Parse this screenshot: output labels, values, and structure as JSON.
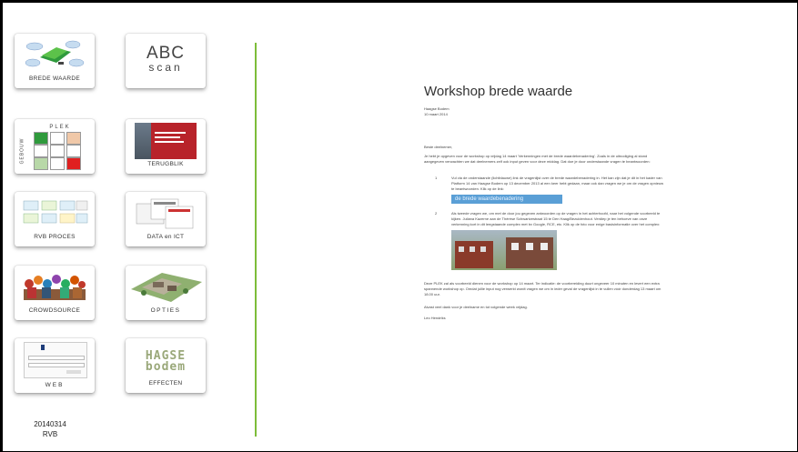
{
  "tiles": {
    "brede_waarde": "BREDE WAARDE",
    "abc_scan": {
      "line1": "ABC",
      "line2": "scan"
    },
    "plek": {
      "top": "PLEK",
      "side": "GEBOUW"
    },
    "terugblik": {
      "caption": "TERUGBLIK"
    },
    "rvb_proces": "RVB PROCES",
    "data_ict": "DATA en ICT",
    "crowdsource": "CROWDSOURCE",
    "opties": "OPTIES",
    "web": "WEB",
    "effecten": {
      "caption": "EFFECTEN",
      "logo_line1": "HAGSE",
      "logo_line2": "bodem"
    }
  },
  "footer": {
    "date": "20140314",
    "org": "RVB"
  },
  "document": {
    "title": "Workshop brede waarde",
    "subtitle_line1": "Haagse Bodem",
    "subtitle_line2": "10 maart 2014",
    "greeting": "Beste deelnemer,",
    "intro": "Je hebt je opgeven voor de workshop op vrijdag 14 maart 'Verkenningen met de brede waardebenadering'. Zoals in de uitnodiging al stond aangegeven verwachten we dat deelnemers zelf ook input geven voor deze middag. Dat doe je door onderstaande vragen te beantwoorden:",
    "item1_num": "1",
    "item1_text": "Vul via de onderstaande (lichtblauwe) link de vragenlijst over de brede waardebenadering in. Het kan zijn dat je dit in het kader van Platform 14 van Haagse Bodem op 13 december 2013 al een keer hebt gedaan, maar ook dan vragen we je om de vragen opnieuw te beantwoorden. Klik op de link:",
    "link_text": "de brede waardebenadering",
    "item2_num": "2",
    "item2_text": "Als tweede vragen we, om met de door jou gegeven antwoorden op de vragen in het achterhoofd, naar het volgende voorbeeld te kijken. Juliana Kazerne aan de Thérèse Schwartzestraat 15 te Den Haag/Bezuidenhout. Verdiep je ten behoeve van onze verkenning kort in dit leegstaande complex met bv Google, RCE, etc. Klik op de foto voor enige basisinformatie over het complex:",
    "outro": "Deze PLEK zal als voorbeeld dienen voor de workshop op 14 maart. Ter indicatie: de voorbereiding duurt ongeveer 10 minuten en levert een extra spannende workshop op. Omdat jullie input nog verwerkt wordt vragen we om in ieder geval de vragenlijst in te vullen vóór donderdag 13 maart om 18.00 uur.",
    "thanks": "Alvast veel dank voor je deelname en tot volgende week vrijdag.",
    "signature": "Leo Hendriks"
  },
  "colors": {
    "divider": "#7dbd3a",
    "link_bg": "#5a9fd6"
  }
}
